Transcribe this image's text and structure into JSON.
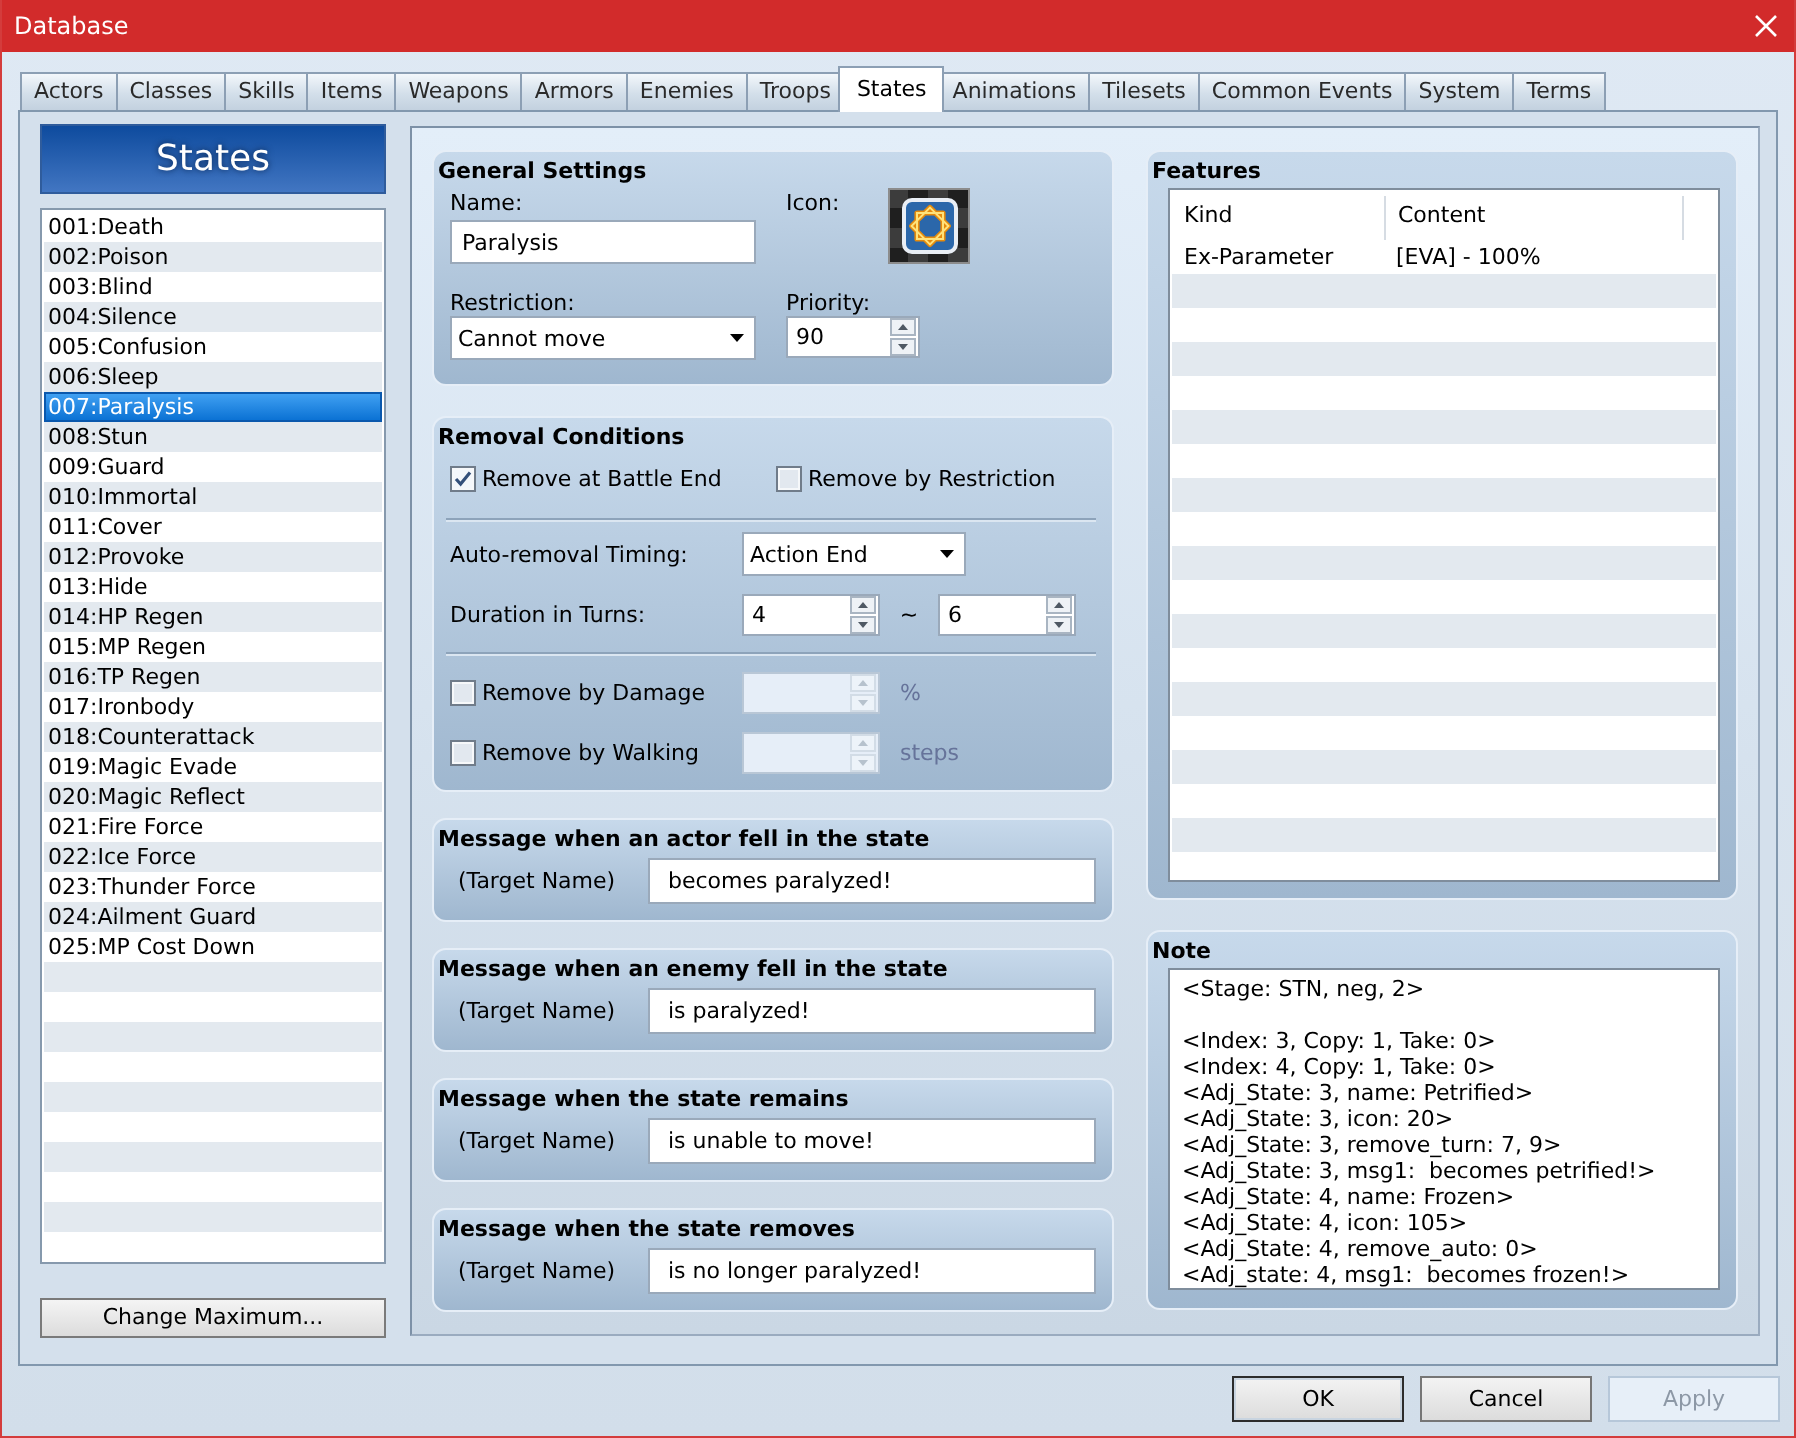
{
  "window": {
    "title": "Database"
  },
  "tabs": [
    {
      "label": "Actors",
      "selected": false
    },
    {
      "label": "Classes",
      "selected": false
    },
    {
      "label": "Skills",
      "selected": false
    },
    {
      "label": "Items",
      "selected": false
    },
    {
      "label": "Weapons",
      "selected": false
    },
    {
      "label": "Armors",
      "selected": false
    },
    {
      "label": "Enemies",
      "selected": false
    },
    {
      "label": "Troops",
      "selected": false
    },
    {
      "label": "States",
      "selected": true
    },
    {
      "label": "Animations",
      "selected": false
    },
    {
      "label": "Tilesets",
      "selected": false
    },
    {
      "label": "Common Events",
      "selected": false
    },
    {
      "label": "System",
      "selected": false
    },
    {
      "label": "Terms",
      "selected": false
    }
  ],
  "states_list": {
    "header": "States",
    "items": [
      {
        "label": "001:Death",
        "selected": false
      },
      {
        "label": "002:Poison",
        "selected": false
      },
      {
        "label": "003:Blind",
        "selected": false
      },
      {
        "label": "004:Silence",
        "selected": false
      },
      {
        "label": "005:Confusion",
        "selected": false
      },
      {
        "label": "006:Sleep",
        "selected": false
      },
      {
        "label": "007:Paralysis",
        "selected": true
      },
      {
        "label": "008:Stun",
        "selected": false
      },
      {
        "label": "009:Guard",
        "selected": false
      },
      {
        "label": "010:Immortal",
        "selected": false
      },
      {
        "label": "011:Cover",
        "selected": false
      },
      {
        "label": "012:Provoke",
        "selected": false
      },
      {
        "label": "013:Hide",
        "selected": false
      },
      {
        "label": "014:HP Regen",
        "selected": false
      },
      {
        "label": "015:MP Regen",
        "selected": false
      },
      {
        "label": "016:TP Regen",
        "selected": false
      },
      {
        "label": "017:Ironbody",
        "selected": false
      },
      {
        "label": "018:Counterattack",
        "selected": false
      },
      {
        "label": "019:Magic Evade",
        "selected": false
      },
      {
        "label": "020:Magic Reflect",
        "selected": false
      },
      {
        "label": "021:Fire Force",
        "selected": false
      },
      {
        "label": "022:Ice Force",
        "selected": false
      },
      {
        "label": "023:Thunder Force",
        "selected": false
      },
      {
        "label": "024:Ailment Guard",
        "selected": false
      },
      {
        "label": "025:MP Cost Down",
        "selected": false
      }
    ],
    "button": "Change Maximum..."
  },
  "general_settings": {
    "title": "General Settings",
    "name": {
      "label": "Name:",
      "value": "Paralysis"
    },
    "icon": {
      "label": "Icon:"
    },
    "restriction": {
      "label": "Restriction:",
      "value": "Cannot move"
    },
    "priority": {
      "label": "Priority:",
      "value": "90"
    }
  },
  "removal_conditions": {
    "title": "Removal Conditions",
    "checkboxes": [
      {
        "label": "Remove at Battle End",
        "checked": true
      },
      {
        "label": "Remove by Restriction",
        "checked": false
      }
    ],
    "auto_removal": {
      "label": "Auto-removal Timing:",
      "value": "Action End"
    },
    "duration": {
      "label": "Duration in Turns:",
      "min": "4",
      "separator": "~",
      "max": "6"
    },
    "remove_by": [
      {
        "label": "Remove by Damage",
        "checked": false,
        "disabled": true,
        "unit": "%"
      },
      {
        "label": "Remove by Walking",
        "checked": false,
        "disabled": true,
        "unit": "steps"
      }
    ]
  },
  "messages": [
    {
      "title": "Message when an actor fell in the state",
      "label": "(Target Name)",
      "value": "becomes paralyzed!"
    },
    {
      "title": "Message when an enemy fell in the state",
      "label": "(Target Name)",
      "value": "is paralyzed!"
    },
    {
      "title": "Message when the state remains",
      "label": "(Target Name)",
      "value": "is unable to move!"
    },
    {
      "title": "Message when the state removes",
      "label": "(Target Name)",
      "value": "is no longer paralyzed!"
    }
  ],
  "features": {
    "title": "Features",
    "columns": [
      "Kind",
      "Content"
    ],
    "rows": [
      [
        "Ex-Parameter",
        "[EVA] - 100%"
      ]
    ]
  },
  "note": {
    "title": "Note",
    "text": "<Stage: STN, neg, 2>\n\n<Index: 3, Copy: 1, Take: 0>\n<Index: 4, Copy: 1, Take: 0>\n<Adj_State: 3, name: Petrified>\n<Adj_State: 3, icon: 20>\n<Adj_State: 3, remove_turn: 7, 9>\n<Adj_State: 3, msg1:  becomes petrified!>\n<Adj_State: 4, name: Frozen>\n<Adj_State: 4, icon: 105>\n<Adj_State: 4, remove_auto: 0>\n<Adj_state: 4, msg1:  becomes frozen!>"
  },
  "buttons": [
    {
      "label": "OK",
      "default": true,
      "disabled": false
    },
    {
      "label": "Cancel",
      "default": false,
      "disabled": false
    },
    {
      "label": "Apply",
      "default": false,
      "disabled": true
    }
  ]
}
